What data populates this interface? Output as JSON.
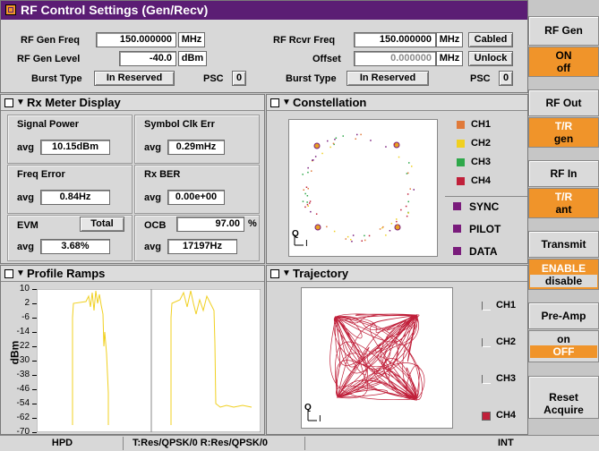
{
  "rf_control": {
    "title": "RF Control Settings (Gen/Recv)",
    "gen_freq_label": "RF Gen Freq",
    "gen_freq_value": "150.000000",
    "gen_freq_unit": "MHz",
    "gen_level_label": "RF Gen Level",
    "gen_level_value": "-40.0",
    "gen_level_unit": "dBm",
    "burst_type_label": "Burst Type",
    "burst_type_value": "In Reserved",
    "psc_label": "PSC",
    "psc_value": "0",
    "rcvr_freq_label": "RF Rcvr Freq",
    "rcvr_freq_value": "150.000000",
    "rcvr_freq_unit": "MHz",
    "cabled_button": "Cabled",
    "offset_label": "Offset",
    "offset_value": "0.000000",
    "offset_unit": "MHz",
    "unlock_button": "Unlock",
    "burst_type_label_2": "Burst Type",
    "burst_type_value_2": "In Reserved",
    "psc_label_2": "PSC",
    "psc_value_2": "0"
  },
  "rx_meter": {
    "title": "Rx Meter Display",
    "signal_power_label": "Signal Power",
    "signal_power_avg": "avg",
    "signal_power_value": "10.15dBm",
    "symbol_clk_label": "Symbol Clk Err",
    "symbol_clk_avg": "avg",
    "symbol_clk_value": "0.29mHz",
    "freq_error_label": "Freq Error",
    "freq_error_avg": "avg",
    "freq_error_value": "0.84Hz",
    "rx_ber_label": "Rx BER",
    "rx_ber_avg": "avg",
    "rx_ber_value": "0.00e+00",
    "evm_label": "EVM",
    "evm_mode": "Total",
    "evm_avg": "avg",
    "evm_value": "3.68%",
    "ocb_label": "OCB",
    "ocb_percent": "97.00",
    "ocb_percent_unit": "%",
    "ocb_avg": "avg",
    "ocb_value": "17197Hz"
  },
  "constellation": {
    "title": "Constellation",
    "axis_q": "Q",
    "axis_i": "I",
    "channels": [
      {
        "label": "CH1",
        "color": "#e07a3a"
      },
      {
        "label": "CH2",
        "color": "#f0d020"
      },
      {
        "label": "CH3",
        "color": "#2ea84a"
      },
      {
        "label": "CH4",
        "color": "#c0203a"
      }
    ],
    "types": [
      {
        "label": "SYNC",
        "color": "#7a1c7c"
      },
      {
        "label": "PILOT",
        "color": "#7a1c7c"
      },
      {
        "label": "DATA",
        "color": "#7a1c7c"
      }
    ]
  },
  "profile_ramps": {
    "title": "Profile Ramps",
    "ylabel": "dBm",
    "ticks": [
      "10",
      "2",
      "-6",
      "-14",
      "-22",
      "-30",
      "-38",
      "-46",
      "-54",
      "-62",
      "-70"
    ],
    "trace_color": "#f0d020"
  },
  "trajectory": {
    "title": "Trajectory",
    "axis_q": "Q",
    "axis_i": "I",
    "trace_color": "#c0203a",
    "channels": [
      {
        "label": "CH1",
        "checked": false
      },
      {
        "label": "CH2",
        "checked": false
      },
      {
        "label": "CH3",
        "checked": false
      },
      {
        "label": "CH4",
        "checked": true
      }
    ]
  },
  "side": {
    "rf_gen": "RF Gen",
    "rf_gen_on": "ON",
    "rf_gen_off": "off",
    "rf_out": "RF Out",
    "rf_out_tr": "T/R",
    "rf_out_gen": "gen",
    "rf_in": "RF In",
    "rf_in_tr": "T/R",
    "rf_in_ant": "ant",
    "transmit": "Transmit",
    "transmit_enable": "ENABLE",
    "transmit_disable": "disable",
    "preamp": "Pre-Amp",
    "preamp_on": "on",
    "preamp_off": "OFF",
    "reset_1": "Reset",
    "reset_2": "Acquire"
  },
  "status": {
    "mode": "HPD",
    "config": "T:Res/QPSK/0 R:Res/QPSK/0",
    "ref": "INT"
  },
  "colors": {
    "title_bar": "#5b1d74",
    "accent": "#f0942a"
  }
}
